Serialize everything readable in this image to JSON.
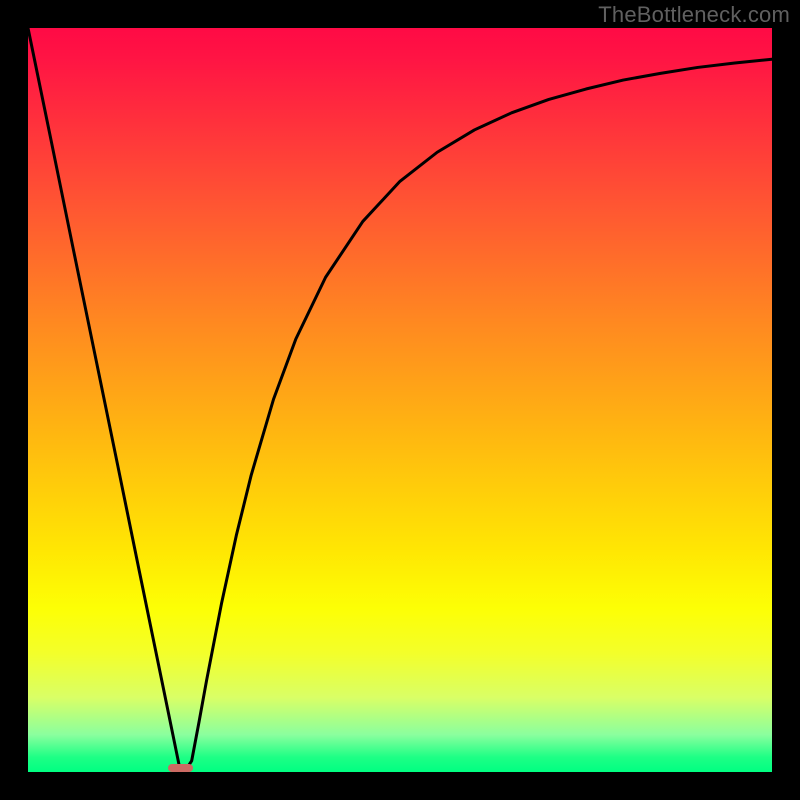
{
  "watermark": {
    "text": "TheBottleneck.com"
  },
  "chart_data": {
    "type": "line",
    "title": "",
    "xlabel": "",
    "ylabel": "",
    "xlim": [
      0,
      100
    ],
    "ylim": [
      0,
      100
    ],
    "grid": false,
    "legend": false,
    "series": [
      {
        "name": "bottleneck-curve",
        "x": [
          0,
          3,
          6,
          9,
          12,
          15,
          18,
          20.5,
          21,
          22,
          23,
          24,
          26,
          28,
          30,
          33,
          36,
          40,
          45,
          50,
          55,
          60,
          65,
          70,
          75,
          80,
          85,
          90,
          95,
          100
        ],
        "y": [
          100,
          85.4,
          70.7,
          56.1,
          41.5,
          26.8,
          12.2,
          0,
          0,
          1.5,
          6.8,
          12.3,
          22.6,
          31.8,
          39.9,
          50.1,
          58.2,
          66.5,
          74.0,
          79.4,
          83.3,
          86.3,
          88.6,
          90.4,
          91.8,
          93.0,
          93.9,
          94.7,
          95.3,
          95.8
        ]
      }
    ],
    "marker": {
      "x_center": 20.5,
      "width_pct": 3.3,
      "height_pct": 1.1
    },
    "gradient_stops": [
      {
        "pct": 0,
        "color": "#ff0a45"
      },
      {
        "pct": 24,
        "color": "#ff5632"
      },
      {
        "pct": 40,
        "color": "#ff8a20"
      },
      {
        "pct": 55,
        "color": "#ffb810"
      },
      {
        "pct": 70,
        "color": "#ffe603"
      },
      {
        "pct": 84,
        "color": "#f3ff2a"
      },
      {
        "pct": 95,
        "color": "#8aff9e"
      },
      {
        "pct": 100,
        "color": "#00ff82"
      }
    ]
  }
}
